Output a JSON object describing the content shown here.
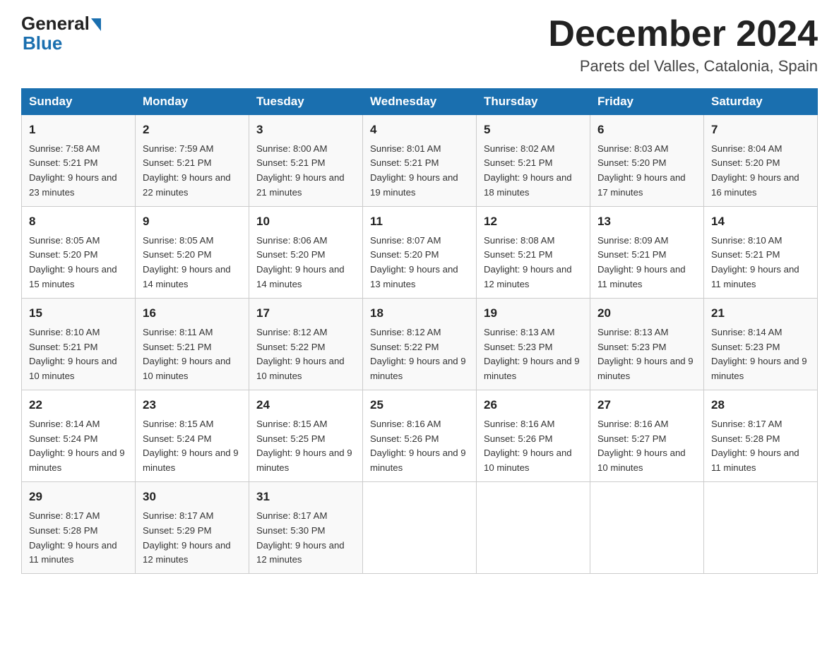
{
  "header": {
    "logo_general": "General",
    "logo_blue": "Blue",
    "month_title": "December 2024",
    "location": "Parets del Valles, Catalonia, Spain"
  },
  "days_of_week": [
    "Sunday",
    "Monday",
    "Tuesday",
    "Wednesday",
    "Thursday",
    "Friday",
    "Saturday"
  ],
  "weeks": [
    [
      {
        "day": "1",
        "sunrise": "7:58 AM",
        "sunset": "5:21 PM",
        "daylight": "9 hours and 23 minutes."
      },
      {
        "day": "2",
        "sunrise": "7:59 AM",
        "sunset": "5:21 PM",
        "daylight": "9 hours and 22 minutes."
      },
      {
        "day": "3",
        "sunrise": "8:00 AM",
        "sunset": "5:21 PM",
        "daylight": "9 hours and 21 minutes."
      },
      {
        "day": "4",
        "sunrise": "8:01 AM",
        "sunset": "5:21 PM",
        "daylight": "9 hours and 19 minutes."
      },
      {
        "day": "5",
        "sunrise": "8:02 AM",
        "sunset": "5:21 PM",
        "daylight": "9 hours and 18 minutes."
      },
      {
        "day": "6",
        "sunrise": "8:03 AM",
        "sunset": "5:20 PM",
        "daylight": "9 hours and 17 minutes."
      },
      {
        "day": "7",
        "sunrise": "8:04 AM",
        "sunset": "5:20 PM",
        "daylight": "9 hours and 16 minutes."
      }
    ],
    [
      {
        "day": "8",
        "sunrise": "8:05 AM",
        "sunset": "5:20 PM",
        "daylight": "9 hours and 15 minutes."
      },
      {
        "day": "9",
        "sunrise": "8:05 AM",
        "sunset": "5:20 PM",
        "daylight": "9 hours and 14 minutes."
      },
      {
        "day": "10",
        "sunrise": "8:06 AM",
        "sunset": "5:20 PM",
        "daylight": "9 hours and 14 minutes."
      },
      {
        "day": "11",
        "sunrise": "8:07 AM",
        "sunset": "5:20 PM",
        "daylight": "9 hours and 13 minutes."
      },
      {
        "day": "12",
        "sunrise": "8:08 AM",
        "sunset": "5:21 PM",
        "daylight": "9 hours and 12 minutes."
      },
      {
        "day": "13",
        "sunrise": "8:09 AM",
        "sunset": "5:21 PM",
        "daylight": "9 hours and 11 minutes."
      },
      {
        "day": "14",
        "sunrise": "8:10 AM",
        "sunset": "5:21 PM",
        "daylight": "9 hours and 11 minutes."
      }
    ],
    [
      {
        "day": "15",
        "sunrise": "8:10 AM",
        "sunset": "5:21 PM",
        "daylight": "9 hours and 10 minutes."
      },
      {
        "day": "16",
        "sunrise": "8:11 AM",
        "sunset": "5:21 PM",
        "daylight": "9 hours and 10 minutes."
      },
      {
        "day": "17",
        "sunrise": "8:12 AM",
        "sunset": "5:22 PM",
        "daylight": "9 hours and 10 minutes."
      },
      {
        "day": "18",
        "sunrise": "8:12 AM",
        "sunset": "5:22 PM",
        "daylight": "9 hours and 9 minutes."
      },
      {
        "day": "19",
        "sunrise": "8:13 AM",
        "sunset": "5:23 PM",
        "daylight": "9 hours and 9 minutes."
      },
      {
        "day": "20",
        "sunrise": "8:13 AM",
        "sunset": "5:23 PM",
        "daylight": "9 hours and 9 minutes."
      },
      {
        "day": "21",
        "sunrise": "8:14 AM",
        "sunset": "5:23 PM",
        "daylight": "9 hours and 9 minutes."
      }
    ],
    [
      {
        "day": "22",
        "sunrise": "8:14 AM",
        "sunset": "5:24 PM",
        "daylight": "9 hours and 9 minutes."
      },
      {
        "day": "23",
        "sunrise": "8:15 AM",
        "sunset": "5:24 PM",
        "daylight": "9 hours and 9 minutes."
      },
      {
        "day": "24",
        "sunrise": "8:15 AM",
        "sunset": "5:25 PM",
        "daylight": "9 hours and 9 minutes."
      },
      {
        "day": "25",
        "sunrise": "8:16 AM",
        "sunset": "5:26 PM",
        "daylight": "9 hours and 9 minutes."
      },
      {
        "day": "26",
        "sunrise": "8:16 AM",
        "sunset": "5:26 PM",
        "daylight": "9 hours and 10 minutes."
      },
      {
        "day": "27",
        "sunrise": "8:16 AM",
        "sunset": "5:27 PM",
        "daylight": "9 hours and 10 minutes."
      },
      {
        "day": "28",
        "sunrise": "8:17 AM",
        "sunset": "5:28 PM",
        "daylight": "9 hours and 11 minutes."
      }
    ],
    [
      {
        "day": "29",
        "sunrise": "8:17 AM",
        "sunset": "5:28 PM",
        "daylight": "9 hours and 11 minutes."
      },
      {
        "day": "30",
        "sunrise": "8:17 AM",
        "sunset": "5:29 PM",
        "daylight": "9 hours and 12 minutes."
      },
      {
        "day": "31",
        "sunrise": "8:17 AM",
        "sunset": "5:30 PM",
        "daylight": "9 hours and 12 minutes."
      },
      null,
      null,
      null,
      null
    ]
  ]
}
